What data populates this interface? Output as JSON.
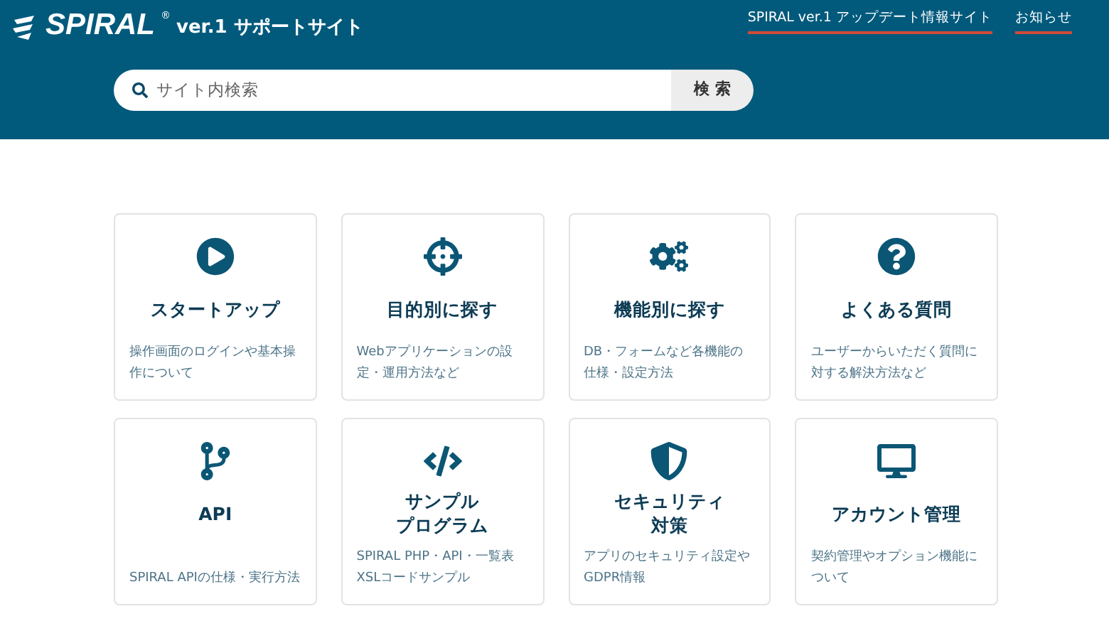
{
  "header": {
    "logo": "SPIRAL",
    "logo_mark": "®",
    "site_name": "ver.1 サポートサイト",
    "links": [
      "SPIRAL ver.1 アップデート情報サイト",
      "お知らせ"
    ]
  },
  "search": {
    "placeholder": "サイト内検索",
    "button": "検 索"
  },
  "cards": [
    {
      "title": [
        "スタートアップ"
      ],
      "description": "操作画面のログインや基本操作について"
    },
    {
      "title": [
        "目的別に探す"
      ],
      "description": "Webアプリケーションの設定・運用方法など"
    },
    {
      "title": [
        "機能別に探す"
      ],
      "description": "DB・フォームなど各機能の仕様・設定方法"
    },
    {
      "title": [
        "よくある質問"
      ],
      "description": "ユーザーからいただく質問に対する解決方法など"
    },
    {
      "title": [
        "API"
      ],
      "description": "SPIRAL APIの仕様・実行方法"
    },
    {
      "title": [
        "サンプル",
        "プログラム"
      ],
      "description": "SPIRAL PHP・API・一覧表XSLコードサンプル"
    },
    {
      "title": [
        "セキュリティ",
        "対策"
      ],
      "description": "アプリのセキュリティ設定やGDPR情報"
    },
    {
      "title": [
        "アカウント管理"
      ],
      "description": "契約管理やオプション機能について"
    }
  ]
}
